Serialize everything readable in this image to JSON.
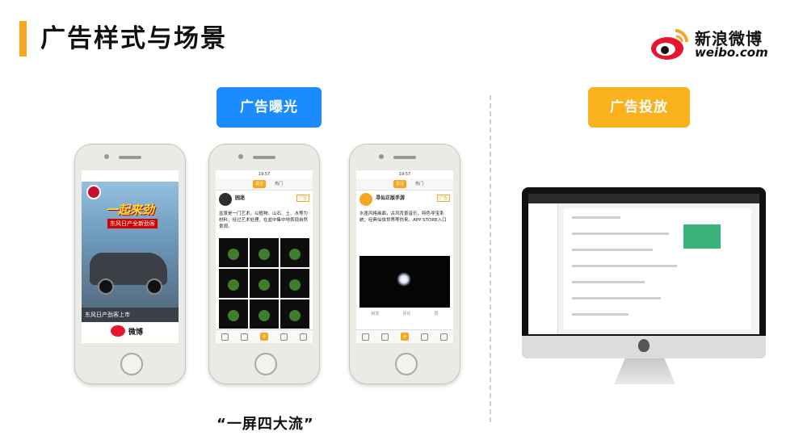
{
  "header": {
    "title": "广告样式与场景"
  },
  "brand": {
    "name_cn": "新浪微博",
    "domain": "weibo.com",
    "logo_icon": "weibo-eye-icon"
  },
  "sections": {
    "exposure_label": "广告曝光",
    "delivery_label": "广告投放"
  },
  "phone1": {
    "slogan": "一起来劲",
    "subline": "东风日产全新劲客",
    "caption": "东风日产劲客上市",
    "app_name": "微博"
  },
  "phone2": {
    "status": "19:57",
    "tabs": [
      "关注",
      "热门"
    ],
    "user": "园迷",
    "badge": "广告",
    "text": "盆景是一门艺术，以植物、山石、土、水等为材料，经过艺术处理，在盆中集中地表现自然景观。"
  },
  "phone3": {
    "status": "19:57",
    "tabs": [
      "关注",
      "热门"
    ],
    "user": "寻仙正版手游",
    "badge": "广告",
    "text": "水墨风格画面，古风背景音乐，特色寻宝系统，经典仙侠世界等你来。APP STORE入口",
    "actions": [
      "转发",
      "评论",
      "赞"
    ]
  },
  "colors": {
    "accent": "#f5a623",
    "blue": "#1a8cff",
    "orange": "#f9b11d",
    "weibo_red": "#e6162d"
  },
  "footer": {
    "caption": "“一屏四大流”"
  }
}
